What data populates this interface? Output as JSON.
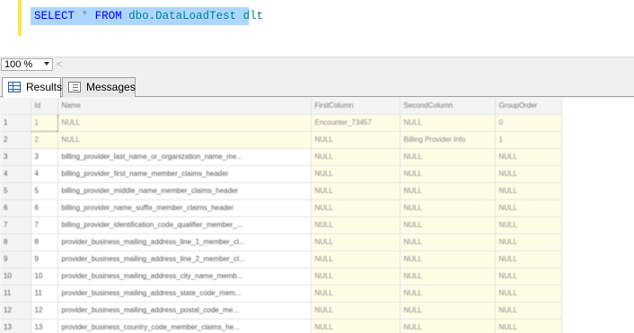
{
  "editor": {
    "kw_select": "SELECT",
    "op_star": "*",
    "kw_from": "FROM",
    "table_name": "dbo.DataLoadTest",
    "alias": "dlt"
  },
  "zoom": {
    "value": "100 %",
    "scroll_left_glyph": "<"
  },
  "tabs": {
    "results_label": "Results",
    "messages_label": "Messages"
  },
  "grid": {
    "columns": [
      "Id",
      "Name",
      "FirstColumn",
      "SecondColumn",
      "GroupOrder"
    ],
    "rows": [
      [
        "1",
        "1",
        "NULL",
        "Encounter_73457",
        "NULL",
        "0"
      ],
      [
        "2",
        "2",
        "NULL",
        "NULL",
        "Billing Provider Info",
        "1"
      ],
      [
        "3",
        "3",
        "billing_provider_last_name_or_organization_name_me...",
        "NULL",
        "NULL",
        "NULL"
      ],
      [
        "4",
        "4",
        "billing_provider_first_name_member_claims_header",
        "NULL",
        "NULL",
        "NULL"
      ],
      [
        "5",
        "5",
        "billing_provider_middle_name_member_claims_header",
        "NULL",
        "NULL",
        "NULL"
      ],
      [
        "6",
        "6",
        "billing_provider_name_suffix_member_claims_header",
        "NULL",
        "NULL",
        "NULL"
      ],
      [
        "7",
        "7",
        "billing_provider_identification_code_qualifier_member_...",
        "NULL",
        "NULL",
        "NULL"
      ],
      [
        "8",
        "8",
        "provider_business_mailing_address_line_1_member_cl...",
        "NULL",
        "NULL",
        "NULL"
      ],
      [
        "9",
        "9",
        "provider_business_mailing_address_line_2_member_cl...",
        "NULL",
        "NULL",
        "NULL"
      ],
      [
        "10",
        "10",
        "provider_business_mailing_address_city_name_memb...",
        "NULL",
        "NULL",
        "NULL"
      ],
      [
        "11",
        "11",
        "provider_business_mailing_address_state_code_mem...",
        "NULL",
        "NULL",
        "NULL"
      ],
      [
        "12",
        "12",
        "provider_business_mailing_address_postal_code_me...",
        "NULL",
        "NULL",
        "NULL"
      ],
      [
        "13",
        "13",
        "provider_business_country_code_member_claims_he...",
        "NULL",
        "NULL",
        "NULL"
      ]
    ]
  }
}
